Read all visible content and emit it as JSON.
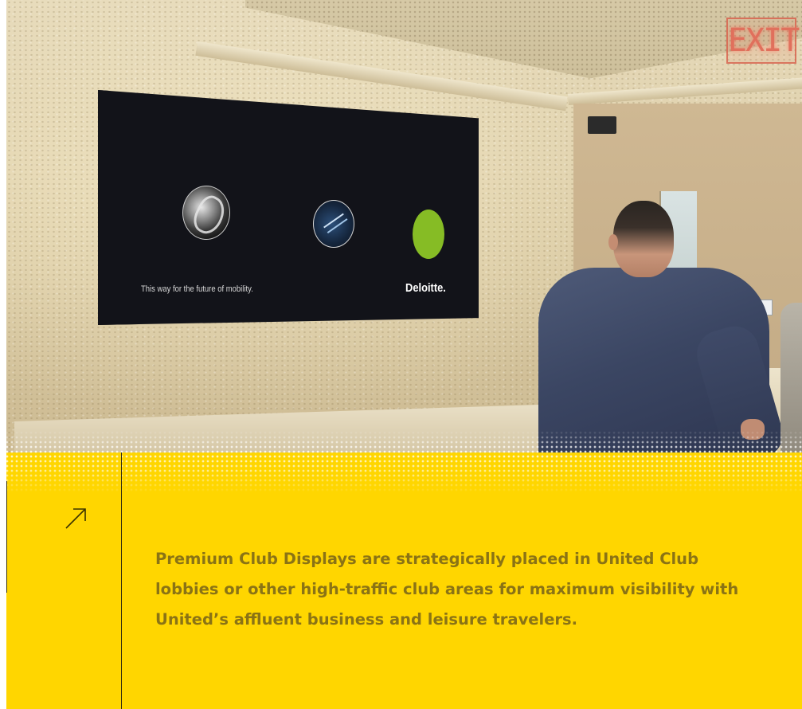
{
  "photo": {
    "exit_sign": "EXIT",
    "billboard": {
      "tagline": "This way for the future of mobility.",
      "logo": "Deloitte."
    }
  },
  "panel": {
    "icon": "arrow-up-right-icon",
    "caption": "Premium Club Displays are strategically placed in United Club lobbies or other high-traffic club areas for maximum visibility with United’s affluent business and leisure travelers."
  },
  "colors": {
    "panel_background": "#ffd600",
    "caption_text": "#8a7315",
    "deloitte_green": "#86bc25"
  }
}
